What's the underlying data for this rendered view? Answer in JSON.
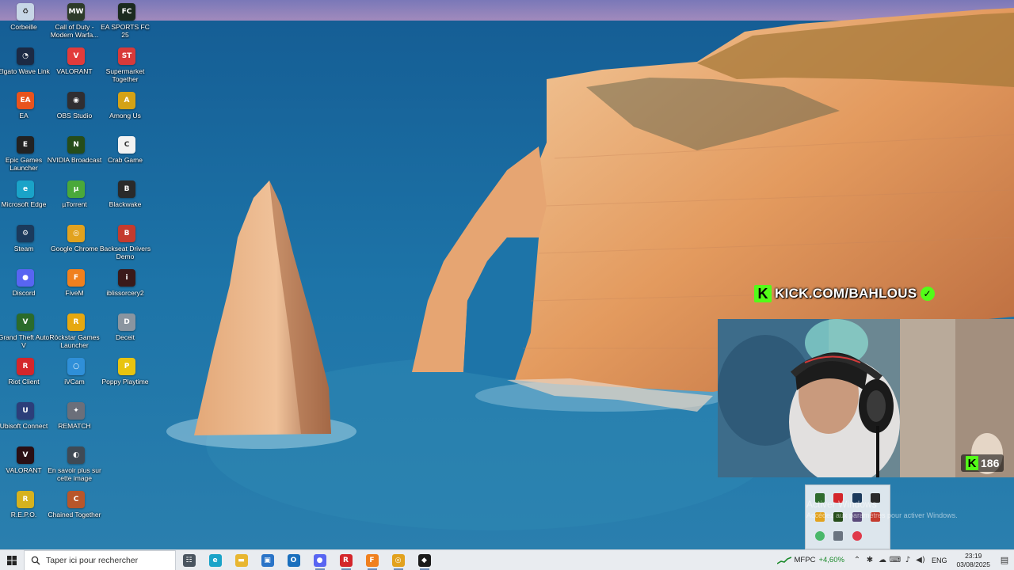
{
  "desktop": {
    "icons": [
      {
        "label": "Corbeille",
        "icon": "recycle-bin-icon",
        "color": "#c7d6e6",
        "glyph": "♻"
      },
      {
        "label": "Elgato Wave Link",
        "icon": "elgato-icon",
        "color": "#1c2a44",
        "glyph": "◔"
      },
      {
        "label": "EA",
        "icon": "ea-icon",
        "color": "#e8531d",
        "glyph": "EA"
      },
      {
        "label": "Epic Games Launcher",
        "icon": "epic-games-icon",
        "color": "#222222",
        "glyph": "E"
      },
      {
        "label": "Microsoft Edge",
        "icon": "edge-icon",
        "color": "#1aa3c8",
        "glyph": "e"
      },
      {
        "label": "Steam",
        "icon": "steam-icon",
        "color": "#1b3a5c",
        "glyph": "⚙"
      },
      {
        "label": "Discord",
        "icon": "discord-icon",
        "color": "#5865f2",
        "glyph": "●"
      },
      {
        "label": "Grand Theft Auto V",
        "icon": "gta-icon",
        "color": "#2b6b2b",
        "glyph": "V"
      },
      {
        "label": "Riot Client",
        "icon": "riot-icon",
        "color": "#d4262b",
        "glyph": "R"
      },
      {
        "label": "Ubisoft Connect",
        "icon": "ubisoft-icon",
        "color": "#2c3e7a",
        "glyph": "U"
      },
      {
        "label": "VALORANT",
        "icon": "valorant-icon",
        "color": "#2a0f14",
        "glyph": "V"
      },
      {
        "label": "R.E.P.O.",
        "icon": "repo-icon",
        "color": "#d6b21e",
        "glyph": "R"
      },
      {
        "label": "Call of Duty - Modern Warfa...",
        "icon": "call-of-duty-icon",
        "color": "#2d3b2a",
        "glyph": "MW"
      },
      {
        "label": "VALORANT",
        "icon": "valorant-riot-icon",
        "color": "#e23b3b",
        "glyph": "V"
      },
      {
        "label": "OBS Studio",
        "icon": "obs-icon",
        "color": "#302e31",
        "glyph": "◉"
      },
      {
        "label": "NVIDIA Broadcast",
        "icon": "nvidia-icon",
        "color": "#264d1a",
        "glyph": "N"
      },
      {
        "label": "µTorrent",
        "icon": "utorrent-icon",
        "color": "#4aa93a",
        "glyph": "µ"
      },
      {
        "label": "Google Chrome",
        "icon": "chrome-icon",
        "color": "#e2a21e",
        "glyph": "◎"
      },
      {
        "label": "FiveM",
        "icon": "fivem-icon",
        "color": "#f0801e",
        "glyph": "F"
      },
      {
        "label": "Röckstar Games Launcher",
        "icon": "rockstar-icon",
        "color": "#e6a80f",
        "glyph": "R"
      },
      {
        "label": "iVCam",
        "icon": "ivcam-icon",
        "color": "#2f8fd8",
        "glyph": "○"
      },
      {
        "label": "REMATCH",
        "icon": "rematch-icon",
        "color": "#6b6f7a",
        "glyph": "✦"
      },
      {
        "label": "En savoir plus sur cette image",
        "icon": "info-camera-icon",
        "color": "#3f4a55",
        "glyph": "◐"
      },
      {
        "label": "Chained Together",
        "icon": "chained-together-icon",
        "color": "#b8562a",
        "glyph": "C"
      },
      {
        "label": "EA SPORTS FC 25",
        "icon": "ea-sports-fc-icon",
        "color": "#1b2a1f",
        "glyph": "FC"
      },
      {
        "label": "Supermarket Together",
        "icon": "supermarket-icon",
        "color": "#d83a3a",
        "glyph": "ST"
      },
      {
        "label": "Among Us",
        "icon": "among-us-icon",
        "color": "#d4a216",
        "glyph": "A"
      },
      {
        "label": "Crab Game",
        "icon": "crab-game-icon",
        "color": "#f2f2f2",
        "glyph": "C"
      },
      {
        "label": "Blackwake",
        "icon": "blackwake-icon",
        "color": "#2a2a2a",
        "glyph": "B"
      },
      {
        "label": "Backseat Drivers Demo",
        "icon": "backseat-drivers-icon",
        "color": "#c43b2e",
        "glyph": "B"
      },
      {
        "label": "iblissorcery2",
        "icon": "iblissorcery-icon",
        "color": "#3a1a1a",
        "glyph": "i"
      },
      {
        "label": "Deceit",
        "icon": "deceit-icon",
        "color": "#8a95a0",
        "glyph": "D"
      },
      {
        "label": "Poppy Playtime",
        "icon": "poppy-playtime-icon",
        "color": "#e8c410",
        "glyph": "P"
      }
    ]
  },
  "overlays": {
    "kick_text": "KICK.COM/BAHLOUS",
    "kick_letter": "K",
    "viewer_count": "186",
    "activate_title": "Activer Windows",
    "activate_sub": "Accédez aux paramètres pour activer Windows."
  },
  "taskbar": {
    "search_placeholder": "Taper ici pour rechercher",
    "apps": [
      {
        "icon": "task-view-icon",
        "color": "#4a5560",
        "glyph": "☷",
        "running": false
      },
      {
        "icon": "edge-taskbar-icon",
        "color": "#1aa3c8",
        "glyph": "e",
        "running": false
      },
      {
        "icon": "file-explorer-icon",
        "color": "#e8b631",
        "glyph": "▬",
        "running": false
      },
      {
        "icon": "store-icon",
        "color": "#2a74c8",
        "glyph": "▣",
        "running": false
      },
      {
        "icon": "outlook-icon",
        "color": "#1a6fbd",
        "glyph": "O",
        "running": false
      },
      {
        "icon": "discord-taskbar-icon",
        "color": "#5865f2",
        "glyph": "●",
        "running": true
      },
      {
        "icon": "riot-taskbar-icon",
        "color": "#d4262b",
        "glyph": "R",
        "running": true
      },
      {
        "icon": "fivem-taskbar-icon",
        "color": "#f0801e",
        "glyph": "F",
        "running": true
      },
      {
        "icon": "chrome-taskbar-icon",
        "color": "#e2a21e",
        "glyph": "◎",
        "running": true
      },
      {
        "icon": "vanguard-taskbar-icon",
        "color": "#1b1b1b",
        "glyph": "◆",
        "running": true
      }
    ],
    "stock_name": "MFPC",
    "stock_change": "+4,60%",
    "language": "ENG",
    "time": "23:19",
    "date": "03/08/2025"
  }
}
